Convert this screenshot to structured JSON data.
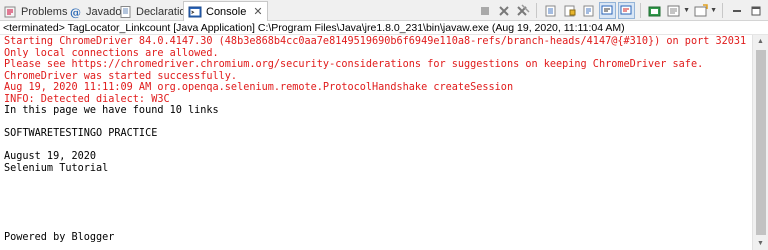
{
  "tabs": [
    {
      "label": "Problems",
      "icon": "problems-icon",
      "active": false
    },
    {
      "label": "Javadoc",
      "icon": "javadoc-icon",
      "active": false
    },
    {
      "label": "Declaration",
      "icon": "declaration-icon",
      "active": false
    },
    {
      "label": "Console",
      "icon": "console-icon",
      "active": true
    }
  ],
  "toolbar_icons": [
    "terminate-icon",
    "remove-launch-icon",
    "remove-all-terminated-icon",
    "clear-console-icon",
    "scroll-lock-icon",
    "word-wrap-icon",
    "show-on-stdout-icon",
    "show-on-stderr-icon",
    "pin-console-icon",
    "display-selected-console-icon",
    "open-console-icon",
    "minimize-icon",
    "maximize-icon"
  ],
  "status_line": "<terminated> TagLocator_Linkcount [Java Application] C:\\Program Files\\Java\\jre1.8.0_231\\bin\\javaw.exe (Aug 19, 2020, 11:11:04 AM)",
  "console_lines": [
    {
      "text": "Starting ChromeDriver 84.0.4147.30 (48b3e868b4cc0aa7e8149519690b6f6949e110a8-refs/branch-heads/4147@{#310}) on port 32031",
      "stream": "err"
    },
    {
      "text": "Only local connections are allowed.",
      "stream": "err"
    },
    {
      "text": "Please see https://chromedriver.chromium.org/security-considerations for suggestions on keeping ChromeDriver safe.",
      "stream": "err"
    },
    {
      "text": "ChromeDriver was started successfully.",
      "stream": "err"
    },
    {
      "text": "Aug 19, 2020 11:11:09 AM org.openqa.selenium.remote.ProtocolHandshake createSession",
      "stream": "err"
    },
    {
      "text": "INFO: Detected dialect: W3C",
      "stream": "err"
    },
    {
      "text": "In this page we have found 10 links",
      "stream": "out"
    },
    {
      "text": "",
      "stream": "out"
    },
    {
      "text": "SOFTWARETESTINGO PRACTICE",
      "stream": "out"
    },
    {
      "text": "",
      "stream": "out"
    },
    {
      "text": "August 19, 2020",
      "stream": "out"
    },
    {
      "text": "Selenium Tutorial",
      "stream": "out"
    },
    {
      "text": "",
      "stream": "out"
    },
    {
      "text": "",
      "stream": "out"
    },
    {
      "text": "",
      "stream": "out"
    },
    {
      "text": "",
      "stream": "out"
    },
    {
      "text": "",
      "stream": "out"
    },
    {
      "text": "Powered by Blogger",
      "stream": "out"
    }
  ],
  "colors": {
    "stderr": "#e01b1b",
    "stdout": "#000000",
    "accent": "#1a5fb4"
  }
}
